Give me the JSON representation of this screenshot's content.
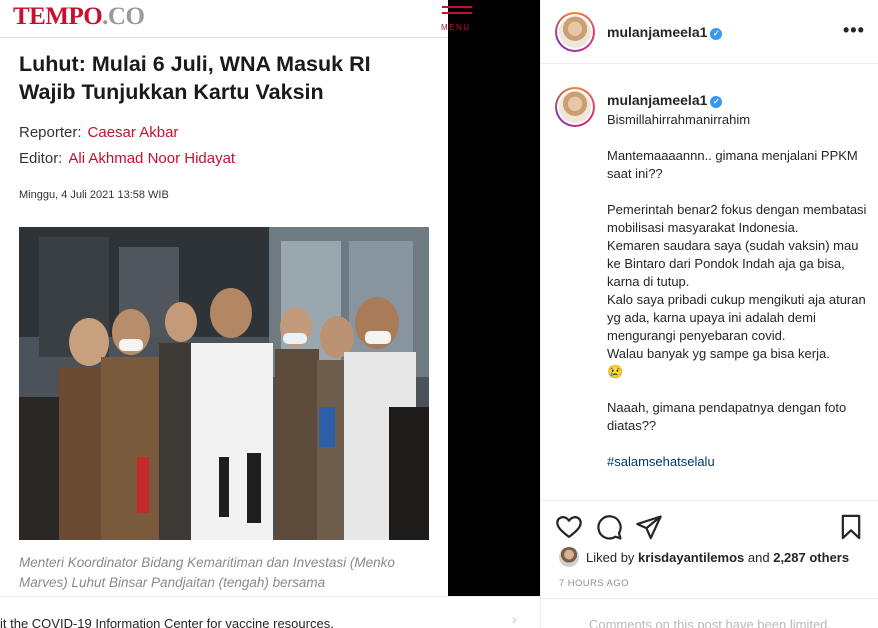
{
  "article": {
    "logo_main": "TEMPO",
    "logo_suffix": ".CO",
    "menu_label": "MENU",
    "title": "Luhut: Mulai 6 Juli, WNA Masuk RI Wajib Tunjukkan Kartu Vaksin",
    "reporter_label": "Reporter:",
    "reporter_name": "Caesar Akbar",
    "editor_label": "Editor:",
    "editor_name": "Ali Akhmad Noor Hidayat",
    "date": "Minggu, 4 Juli 2021 13:58 WIB",
    "caption": "Menteri Koordinator Bidang Kemaritiman dan Investasi (Menko Marves) Luhut Binsar Pandjaitan (tengah) bersama"
  },
  "post": {
    "username": "mulanjameela1",
    "verified_mark": "✓",
    "more_icon": "•••",
    "caption_username": "mulanjameela1",
    "caption_text": "Bismillahirrahmanirrahim\n\nMantemaaaannn.. gimana menjalani PPKM saat ini??\n\nPemerintah benar2 fokus dengan membatasi mobilisasi masyarakat Indonesia.\nKemaren saudara saya (sudah vaksin) mau ke Bintaro dari Pondok Indah aja ga bisa, karna di tutup.\nKalo saya pribadi cukup mengikuti aja aturan yg ada, karna upaya ini adalah demi mengurangi penyebaran covid.\nWalau banyak yg sampe ga bisa kerja.\n😢\n\nNaaah, gimana pendapatnya dengan foto diatas??",
    "hashtag": "#salamsehatselalu",
    "likes_prefix": "Liked by",
    "likes_user": "krisdayantilemos",
    "likes_and": "and",
    "likes_count": "2,287 others",
    "timestamp": "7 HOURS AGO",
    "comments_notice": "Comments on this post have been limited."
  },
  "banner": {
    "text": "it the COVID-19 Information Center for vaccine resources.",
    "chevron": "›"
  },
  "icons": {
    "like": "heart-icon",
    "comment": "comment-icon",
    "share": "paper-plane-icon",
    "save": "bookmark-icon"
  }
}
